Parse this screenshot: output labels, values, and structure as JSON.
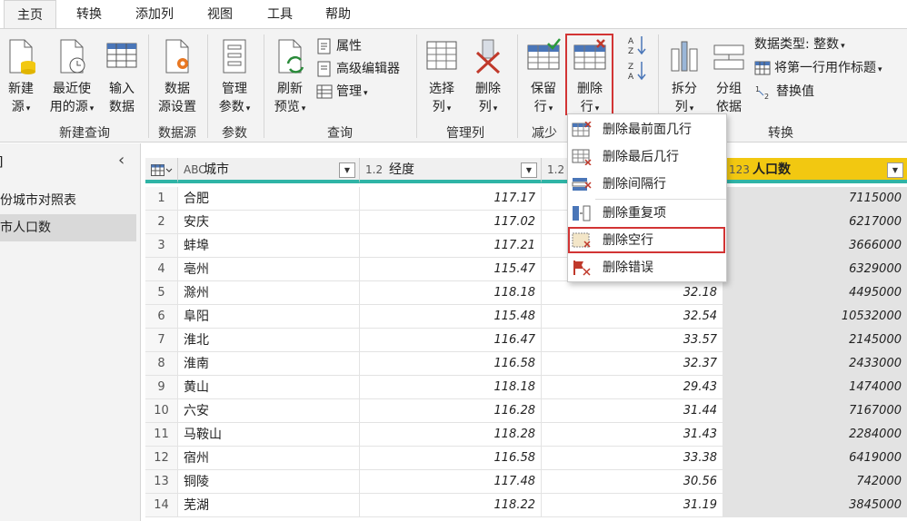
{
  "tabs": [
    "主页",
    "转换",
    "添加列",
    "视图",
    "工具",
    "帮助"
  ],
  "ribbon": {
    "new_source": [
      "新建",
      "源"
    ],
    "recent_sources": [
      "最近使",
      "用的源"
    ],
    "enter_data": [
      "输入",
      "数据"
    ],
    "group_new_query": "新建查询",
    "datasource_settings": [
      "数据",
      "源设置"
    ],
    "group_datasource": "数据源",
    "manage_params": [
      "管理",
      "参数"
    ],
    "group_params": "参数",
    "refresh_preview": [
      "刷新",
      "预览"
    ],
    "properties": "属性",
    "advanced_editor": "高级编辑器",
    "manage": "管理",
    "group_query": "查询",
    "choose_columns": [
      "选择",
      "列"
    ],
    "remove_columns": [
      "删除",
      "列"
    ],
    "group_manage_columns": "管理列",
    "keep_rows": [
      "保留",
      "行"
    ],
    "remove_rows": [
      "删除",
      "行"
    ],
    "group_reduce_rows": "减少",
    "split_column": [
      "拆分",
      "列"
    ],
    "group_by": [
      "分组",
      "依据"
    ],
    "data_type": "数据类型: 整数",
    "use_first_row": "将第一行用作标题",
    "replace_values": "替换值",
    "group_transform": "转换"
  },
  "left_pane": {
    "title": "]",
    "items": [
      "份城市对照表",
      "市人口数"
    ]
  },
  "columns": [
    {
      "type": "ABC",
      "name": "城市"
    },
    {
      "type": "1.2",
      "name": "经度"
    },
    {
      "type": "1.2",
      "name": ""
    },
    {
      "type": "123",
      "name": "人口数"
    }
  ],
  "rows": [
    [
      "1",
      "合肥",
      "117.17",
      "",
      "7115000"
    ],
    [
      "2",
      "安庆",
      "117.02",
      "",
      "6217000"
    ],
    [
      "3",
      "蚌埠",
      "117.21",
      "",
      "3666000"
    ],
    [
      "4",
      "亳州",
      "115.47",
      "",
      "6329000"
    ],
    [
      "5",
      "滁州",
      "118.18",
      "32.18",
      "4495000"
    ],
    [
      "6",
      "阜阳",
      "115.48",
      "32.54",
      "10532000"
    ],
    [
      "7",
      "淮北",
      "116.47",
      "33.57",
      "2145000"
    ],
    [
      "8",
      "淮南",
      "116.58",
      "32.37",
      "2433000"
    ],
    [
      "9",
      "黄山",
      "118.18",
      "29.43",
      "1474000"
    ],
    [
      "10",
      "六安",
      "116.28",
      "31.44",
      "7167000"
    ],
    [
      "11",
      "马鞍山",
      "118.28",
      "31.43",
      "2284000"
    ],
    [
      "12",
      "宿州",
      "116.58",
      "33.38",
      "6419000"
    ],
    [
      "13",
      "铜陵",
      "117.48",
      "30.56",
      "742000"
    ],
    [
      "14",
      "芜湖",
      "118.22",
      "31.19",
      "3845000"
    ]
  ],
  "menu": [
    "删除最前面几行",
    "删除最后几行",
    "删除间隔行",
    "删除重复项",
    "删除空行",
    "删除错误"
  ],
  "colors": {
    "accent_teal": "#2fb4a6",
    "selected_col": "#f2c811",
    "highlight": "#d23434"
  }
}
